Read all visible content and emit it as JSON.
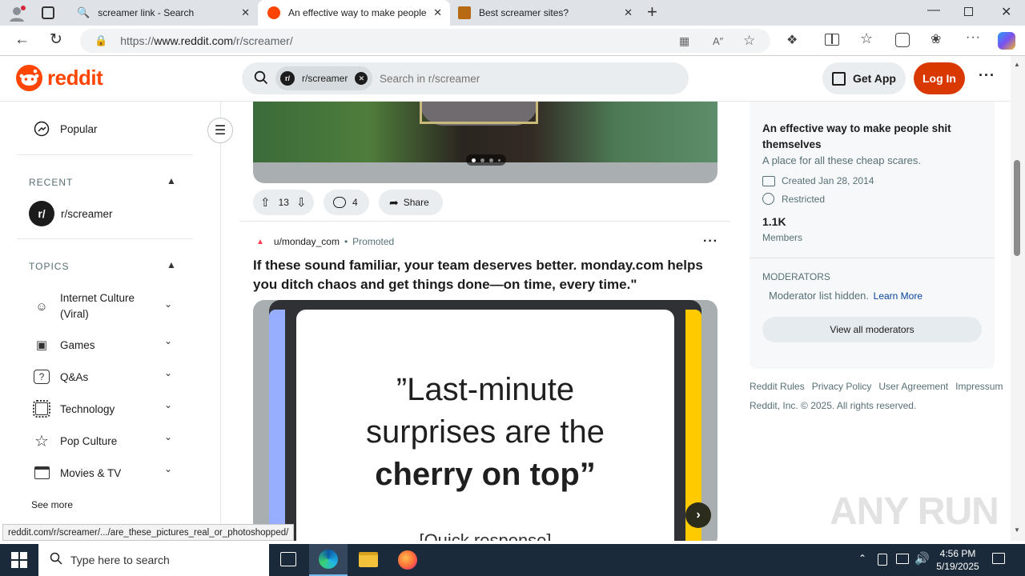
{
  "browser": {
    "tabs": [
      {
        "title": "screamer link - Search",
        "icon": "search-icon",
        "active": false
      },
      {
        "title": "An effective way to make people",
        "icon": "reddit-icon",
        "active": true
      },
      {
        "title": "Best screamer sites?",
        "icon": "site-icon",
        "active": false
      }
    ],
    "url_prefix": "https://",
    "url_host": "www.reddit.com",
    "url_path": "/r/screamer/",
    "status_url": "reddit.com/r/screamer/.../are_these_pictures_real_or_photoshopped/"
  },
  "header": {
    "logo_text": "reddit",
    "search_chip": "r/screamer",
    "search_placeholder": "Search in r/screamer",
    "get_app": "Get App",
    "login": "Log In"
  },
  "sidebar": {
    "popular": "Popular",
    "recent_title": "RECENT",
    "recent_item": "r/screamer",
    "topics_title": "TOPICS",
    "topics": [
      {
        "label": "Internet Culture",
        "label2": "(Viral)",
        "icon": "smile-icon"
      },
      {
        "label": "Games",
        "icon": "gamepad-icon"
      },
      {
        "label": "Q&As",
        "icon": "question-icon"
      },
      {
        "label": "Technology",
        "icon": "chip-icon"
      },
      {
        "label": "Pop Culture",
        "icon": "star-icon"
      },
      {
        "label": "Movies & TV",
        "icon": "clapper-icon"
      }
    ],
    "see_more": "See more"
  },
  "post1": {
    "upvotes": "13",
    "comments": "4",
    "share": "Share"
  },
  "post2": {
    "author": "u/monday_com",
    "promoted": "Promoted",
    "title_line1": "If these sound familiar, your team deserves better. monday.com helps",
    "title_line2": "you ditch chaos and get things done—on time, every time.\"",
    "ad_line1": "”Last-minute",
    "ad_line2": "surprises are the",
    "ad_line3": "cherry on top”",
    "ad_line4": "[Quick response]"
  },
  "community": {
    "title_line1": "An effective way to make people shit",
    "title_line2": "themselves",
    "description": "A place for all these cheap scares.",
    "created": "Created Jan 28, 2014",
    "restricted": "Restricted",
    "members_count": "1.1K",
    "members_label": "Members",
    "moderators_title": "MODERATORS",
    "moderator_hidden": "Moderator list hidden.",
    "learn_more": "Learn More",
    "view_all": "View all moderators"
  },
  "footer": {
    "links": [
      "Reddit Rules",
      "Privacy Policy",
      "User Agreement",
      "Impressum"
    ],
    "copyright": "Reddit, Inc. © 2025. All rights reserved."
  },
  "taskbar": {
    "search_placeholder": "Type here to search",
    "time": "4:56 PM",
    "date": "5/19/2025"
  },
  "watermark": "ANY RUN",
  "colors": {
    "reddit_orange": "#ff4500",
    "login_bg": "#d93900",
    "link_blue": "#0a449b",
    "taskbar": "#1b2a3a",
    "monday_yellow": "#ffcb00",
    "monday_blue": "#97aeff"
  }
}
